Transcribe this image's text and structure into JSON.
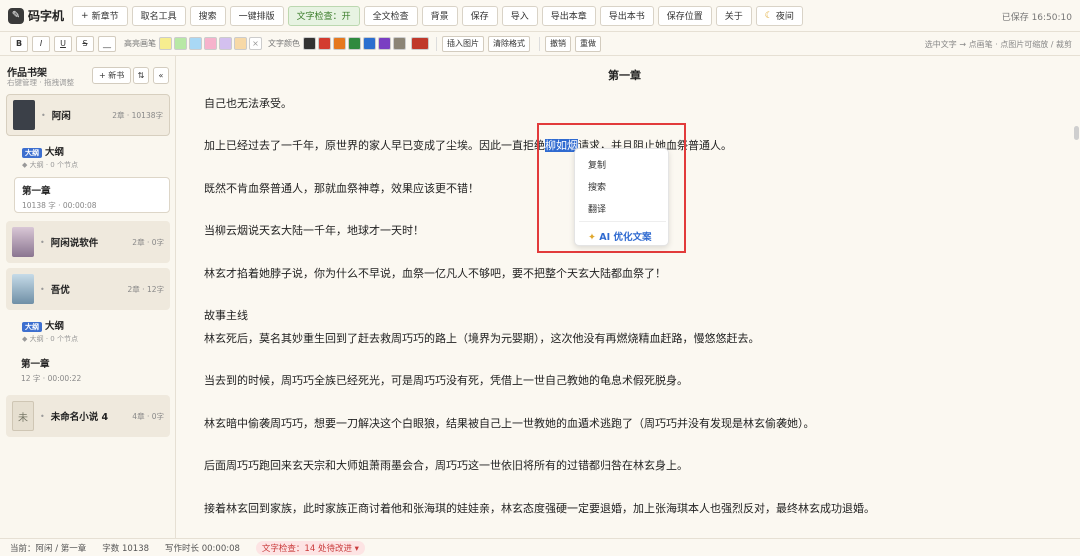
{
  "app": {
    "name": "码字机",
    "saved": "已保存 16:50:10"
  },
  "toolbar": {
    "new_chapter": "新章节",
    "naming_tool": "取名工具",
    "search": "搜索",
    "layout": "一键排版",
    "text_check": "文字检查：开",
    "full_check": "全文检查",
    "background": "背景",
    "save": "保存",
    "import": "导入",
    "export_chapter": "导出本章",
    "export_book": "导出本书",
    "save_position": "保存位置",
    "about": "关于",
    "night": "夜间"
  },
  "format": {
    "bold": "B",
    "italic": "I",
    "underline": "U",
    "strike": "S",
    "line": "__",
    "highlighter_label": "高亮画笔",
    "highlight_colors": [
      "#f6ed8f",
      "#b8e8a6",
      "#a9d8f5",
      "#f6b3cc",
      "#d3c0ef",
      "#f7d9a7"
    ],
    "text_color_label": "文字颜色",
    "text_colors": [
      "#333333",
      "#d33b2f",
      "#e5781e",
      "#2f8a3e",
      "#2b6fcf",
      "#7a3fc2",
      "#8b8475"
    ],
    "current_color": "#d33b2f",
    "insert_image": "插入图片",
    "clear_format": "清除格式",
    "undo": "撤销",
    "redo": "重做",
    "hint": "选中文字 → 点画笔 · 点图片可缩放 / 裁剪"
  },
  "sidebar": {
    "title": "作品书架",
    "subtitle": "右键管理 · 拖拽调整",
    "new_book": "+ 新书",
    "books": [
      {
        "name": "阿闲",
        "meta": "2章 · 10138字",
        "cover_color": "#3b4048"
      },
      {
        "name": "阿闲说软件",
        "meta": "2章 · 0字",
        "cover_color": "#c9b6c4"
      },
      {
        "name": "吾优",
        "meta": "2章 · 12字",
        "cover_color": "#8fb0c6"
      },
      {
        "name": "未命名小说 4",
        "meta": "4章 · 0字",
        "cover_char": "未"
      }
    ],
    "outline_tag": "大纲",
    "outline_title": "大纲",
    "outline_meta": "◆ 大纲 · 0 个节点",
    "chapters": [
      {
        "title": "第一章",
        "meta": "10138 字 · 00:00:08"
      },
      {
        "title": "第一章",
        "meta": "12 字 · 00:00:22"
      }
    ]
  },
  "editor": {
    "chapter_title": "第一章",
    "p1": "自己也无法承受。",
    "p2_before": "加上已经过去了一千年，原世界的家人早已变成了尘埃。因此一直拒绝",
    "p2_selected": "柳如烟",
    "p2_after": "请求，并且阻止她血祭普通人。",
    "p3": "既然不肯血祭普通人，那就血祭神尊，效果应该更不错！",
    "p4": "当柳云烟说天玄大陆一千年，地球才一天时！",
    "p5": "林玄才掐着她脖子说，你为什么不早说，血祭一亿凡人不够吧，要不把整个天玄大陆都血祭了！",
    "p6": "故事主线",
    "p7": "林玄死后，莫名其妙重生回到了赶去救周巧巧的路上（境界为元婴期），这次他没有再燃烧精血赶路，慢悠悠赶去。",
    "p8": "当去到的时候，周巧巧全族已经死光，可是周巧巧没有死，凭借上一世自己教她的龟息术假死脱身。",
    "p9": "林玄暗中偷袭周巧巧，想要一刀解决这个白眼狼，结果被自己上一世教她的血遁术逃跑了（周巧巧并没有发现是林玄偷袭她）。",
    "p10": "后面周巧巧跑回来玄天宗和大师姐萧雨墨会合，周巧巧这一世依旧将所有的过错都归咎在林玄身上。",
    "p11": "接着林玄回到家族，此时家族正商讨着他和张海琪的娃娃亲，林玄态度强硬一定要退婚，加上张海琪本人也强烈反对，最终林玄成功退婚。"
  },
  "context_menu": {
    "copy": "复制",
    "search": "搜索",
    "translate": "翻译",
    "ai": "AI 优化文案"
  },
  "status": {
    "current": "当前：阿闲 / 第一章",
    "words": "字数 10138",
    "time": "写作时长 00:00:08",
    "check": "文字检查：14 处待改进 ▾"
  }
}
